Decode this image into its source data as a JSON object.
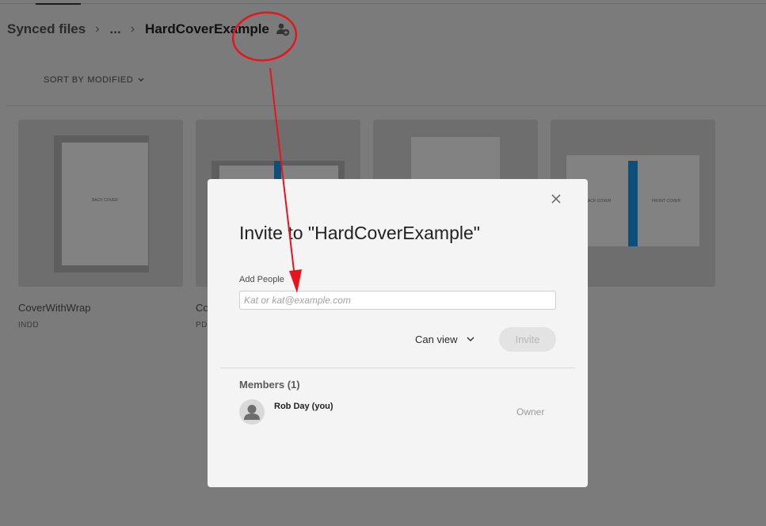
{
  "breadcrumb": {
    "root": "Synced files",
    "ellipsis": "...",
    "current": "HardCoverExample",
    "separator": "›",
    "share_icon": "add-person-icon"
  },
  "sort": {
    "label": "SORT BY",
    "value": "MODIFIED",
    "chevron_icon": "chevron-down-icon"
  },
  "files": [
    {
      "name": "CoverWithWrap",
      "type": "INDD",
      "thumb_text": "BACK COVER"
    },
    {
      "name": "Co",
      "type": "PD"
    },
    {
      "name": "",
      "type": ""
    },
    {
      "name": "",
      "type": "",
      "thumb_left_text": "BACK COVER",
      "thumb_right_text": "FRONT COVER"
    }
  ],
  "modal": {
    "title": "Invite to \"HardCoverExample\"",
    "close_icon": "close-icon",
    "add_people_label": "Add People",
    "input_placeholder": "Kat or kat@example.com",
    "input_value": "",
    "permission": "Can view",
    "permission_chevron_icon": "chevron-down-icon",
    "invite_label": "Invite",
    "members_heading": "Members (1)",
    "members": [
      {
        "name": "Rob Day (you)",
        "role": "Owner",
        "avatar_icon": "user-avatar-icon"
      }
    ]
  },
  "colors": {
    "overlay_background": "#7b7b7b",
    "modal_background": "#f4f4f4",
    "annotation_red": "#e8141c",
    "spine_blue": "#0b6aa8"
  }
}
